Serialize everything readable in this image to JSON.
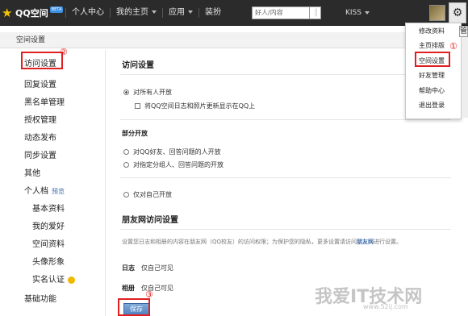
{
  "topbar": {
    "logo_text": "QQ空间",
    "logo_beta": "BETA",
    "nav": [
      "个人中心",
      "我的主页",
      "应用",
      "装扮"
    ],
    "search_placeholder": "好人/内容",
    "username": "KISS"
  },
  "page_header": "空间设置",
  "sidebar": {
    "items": [
      {
        "label": "访问设置"
      },
      {
        "label": "回复设置"
      },
      {
        "label": "黑名单管理"
      },
      {
        "label": "授权管理"
      },
      {
        "label": "动态发布"
      },
      {
        "label": "同步设置"
      },
      {
        "label": "其他"
      },
      {
        "label": "个人档",
        "tag": "预览"
      },
      {
        "label": "基本资料"
      },
      {
        "label": "我的爱好"
      },
      {
        "label": "空间资料"
      },
      {
        "label": "头像形象"
      },
      {
        "label": "实名认证"
      },
      {
        "label": "基础功能"
      }
    ]
  },
  "main": {
    "section1_title": "访问设置",
    "option_all": "对所有人开放",
    "option_all_sub": "将QQ空间日志和照片更新显示在QQ上",
    "section2_title": "部分开放",
    "option_friends": "对QQ好友、回答问题的人开放",
    "option_groups": "对指定分组人、回答问题的开放",
    "option_self": "仅对自己开放",
    "section3_title": "朋友网访问设置",
    "desc_prefix": "设置您日志和相册的内容在朋友网（QQ校友）的访问权限；为保护您的隐私，更多设置请访问",
    "desc_link": "朋友网",
    "desc_suffix": "进行设置。",
    "diary_label": "日志",
    "diary_value": "仅自己可见",
    "album_label": "相册",
    "album_value": "仅自己可见",
    "save_label": "保存"
  },
  "dropdown": {
    "items": [
      "修改资料",
      "主页排版",
      "空间设置",
      "好友管理",
      "帮助中心",
      "退出登录"
    ]
  },
  "annotations": {
    "n1": "①",
    "n2": "②",
    "n3": "③"
  },
  "right_tab": "管",
  "watermark": {
    "main": "我爱IT技术网",
    "sub": "www.52ij.com"
  },
  "colors": {
    "topbar": "#2b2b2b",
    "annotation_red": "#e02020",
    "link_blue": "#3a6aa7"
  }
}
